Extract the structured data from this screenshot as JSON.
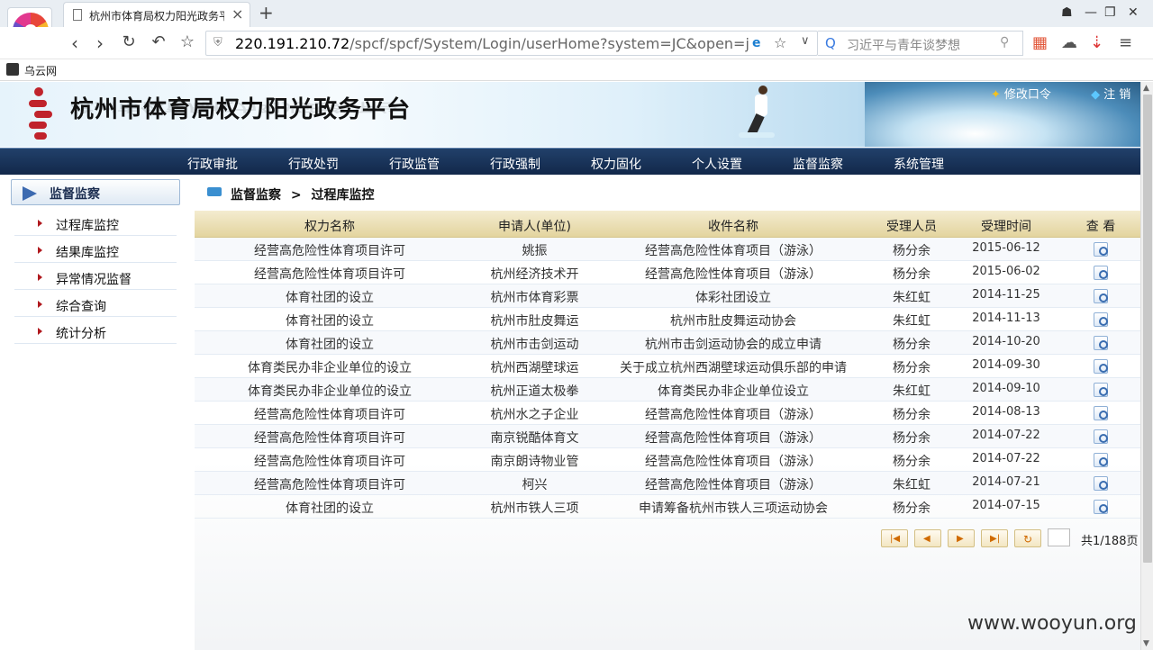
{
  "browser": {
    "tab_title": "杭州市体育局权力阳光政务平台",
    "url_host": "220.191.210.72",
    "url_path": "/spcf/spcf/System/Login/userHome?system=JC&open=jdjc&ur",
    "search_placeholder": "习近平与青年谈梦想",
    "bookmark": "乌云网"
  },
  "header": {
    "title": "杭州市体育局权力阳光政务平台",
    "link_password": "修改口令",
    "link_logout": "注  销"
  },
  "menu": [
    "行政审批",
    "行政处罚",
    "行政监管",
    "行政强制",
    "权力固化",
    "个人设置",
    "监督监察",
    "系统管理"
  ],
  "sidebar": {
    "title": "监督监察",
    "items": [
      "过程库监控",
      "结果库监控",
      "异常情况监督",
      "综合查询",
      "统计分析"
    ]
  },
  "breadcrumb": {
    "section": "监督监察",
    "sep": ">",
    "page": "过程库监控"
  },
  "table": {
    "headers": [
      "权力名称",
      "申请人(单位)",
      "收件名称",
      "受理人员",
      "受理时间",
      "查  看"
    ],
    "rows": [
      [
        "经营高危险性体育项目许可",
        "姚振",
        "经营高危险性体育项目（游泳）",
        "杨分余",
        "2015-06-12"
      ],
      [
        "经营高危险性体育项目许可",
        "杭州经济技术开",
        "经营高危险性体育项目（游泳）",
        "杨分余",
        "2015-06-02"
      ],
      [
        "体育社团的设立",
        "杭州市体育彩票",
        "体彩社团设立",
        "朱红虹",
        "2014-11-25"
      ],
      [
        "体育社团的设立",
        "杭州市肚皮舞运",
        "杭州市肚皮舞运动协会",
        "朱红虹",
        "2014-11-13"
      ],
      [
        "体育社团的设立",
        "杭州市击剑运动",
        "杭州市击剑运动协会的成立申请",
        "杨分余",
        "2014-10-20"
      ],
      [
        "体育类民办非企业单位的设立",
        "杭州西湖壁球运",
        "关于成立杭州西湖壁球运动俱乐部的申请",
        "杨分余",
        "2014-09-30"
      ],
      [
        "体育类民办非企业单位的设立",
        "杭州正道太极拳",
        "体育类民办非企业单位设立",
        "朱红虹",
        "2014-09-10"
      ],
      [
        "经营高危险性体育项目许可",
        "杭州水之子企业",
        "经营高危险性体育项目（游泳）",
        "杨分余",
        "2014-08-13"
      ],
      [
        "经营高危险性体育项目许可",
        "南京锐酷体育文",
        "经营高危险性体育项目（游泳）",
        "杨分余",
        "2014-07-22"
      ],
      [
        "经营高危险性体育项目许可",
        "南京朗诗物业管",
        "经营高危险性体育项目（游泳）",
        "杨分余",
        "2014-07-22"
      ],
      [
        "经营高危险性体育项目许可",
        "柯兴",
        "经营高危险性体育项目（游泳）",
        "朱红虹",
        "2014-07-21"
      ],
      [
        "体育社团的设立",
        "杭州市铁人三项",
        "申请筹备杭州市铁人三项运动协会",
        "杨分余",
        "2014-07-15"
      ]
    ]
  },
  "pager": {
    "total": "共1/188页",
    "current": ""
  },
  "watermark": "www.wooyun.org"
}
